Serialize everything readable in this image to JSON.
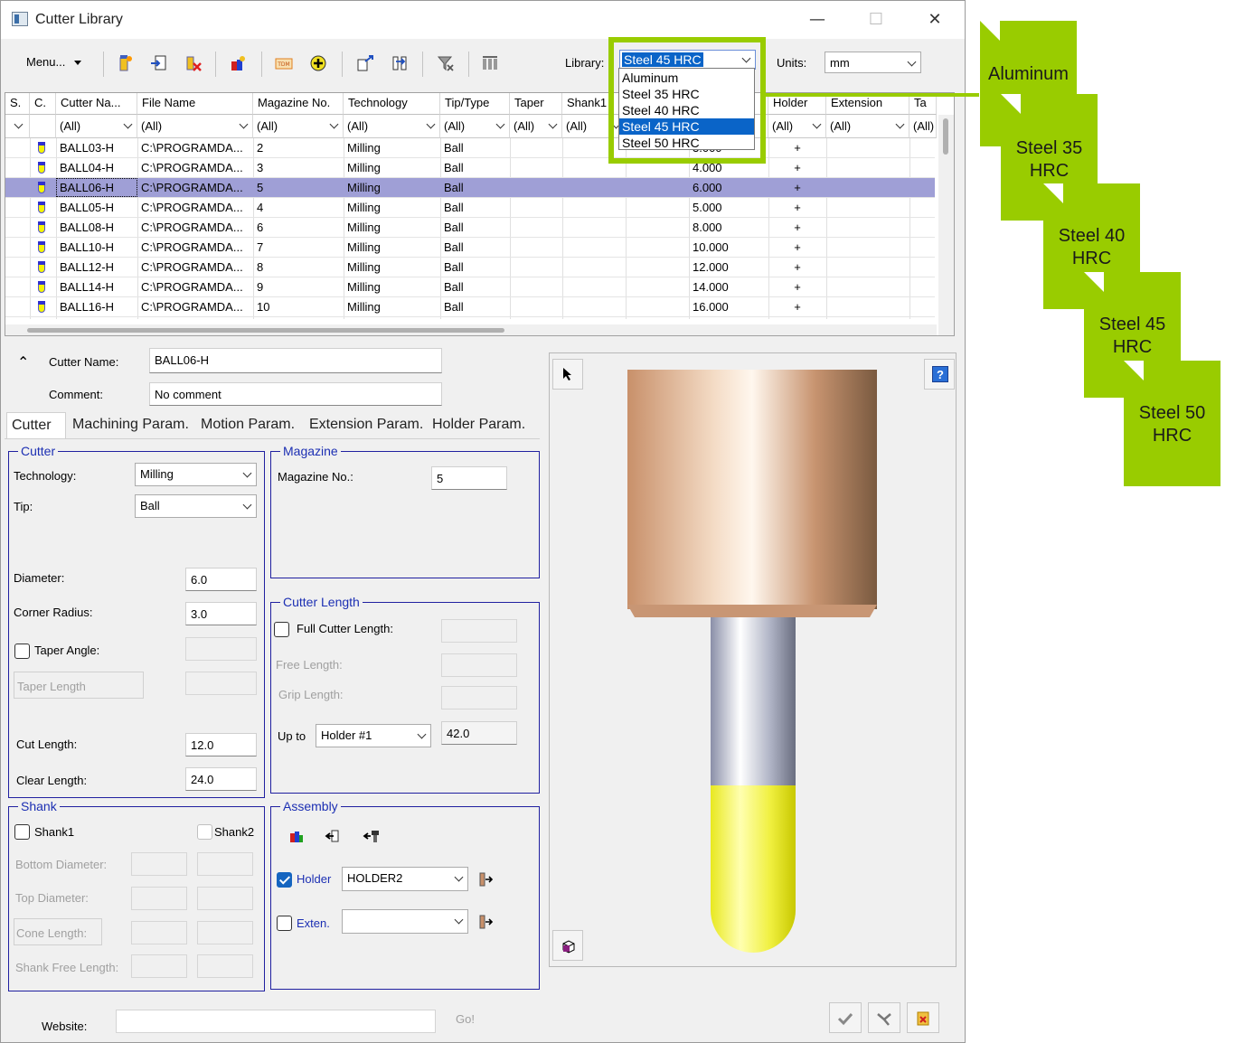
{
  "window": {
    "title": "Cutter Library",
    "minimize_glyph": "—",
    "maximize_glyph": "☐",
    "close_glyph": "✕"
  },
  "toolbar": {
    "menu_label": "Menu...",
    "library_label": "Library:",
    "library_value": "Steel 45 HRC",
    "units_label": "Units:",
    "units_value": "mm",
    "icons": [
      "new-cutter-icon",
      "import-icon",
      "delete-cutter-icon",
      "color-icon",
      "tdm-icon",
      "add-icon",
      "export-icon",
      "transfer-icon",
      "filter-clear-icon",
      "columns-icon"
    ]
  },
  "library_dropdown": {
    "selected": "Steel 45 HRC",
    "options": [
      "Aluminum",
      "Steel 35 HRC",
      "Steel 40 HRC",
      "Steel 45 HRC",
      "Steel 50 HRC"
    ]
  },
  "grid": {
    "columns": [
      "S.",
      "C.",
      "Cutter Na...",
      "File Name",
      "Magazine No.",
      "Technology",
      "Tip/Type",
      "Taper",
      "Shank1",
      "",
      "",
      "Holder",
      "Extension",
      "Ta"
    ],
    "filter_all": "(All)",
    "rows": [
      {
        "name": "BALL03-H",
        "file": "C:\\PROGRAMDA...",
        "mag": "2",
        "tech": "Milling",
        "tip": "Ball",
        "dia": "3.000",
        "holder": "+"
      },
      {
        "name": "BALL04-H",
        "file": "C:\\PROGRAMDA...",
        "mag": "3",
        "tech": "Milling",
        "tip": "Ball",
        "dia": "4.000",
        "holder": "+"
      },
      {
        "name": "BALL06-H",
        "file": "C:\\PROGRAMDA...",
        "mag": "5",
        "tech": "Milling",
        "tip": "Ball",
        "dia": "6.000",
        "holder": "+"
      },
      {
        "name": "BALL05-H",
        "file": "C:\\PROGRAMDA...",
        "mag": "4",
        "tech": "Milling",
        "tip": "Ball",
        "dia": "5.000",
        "holder": "+"
      },
      {
        "name": "BALL08-H",
        "file": "C:\\PROGRAMDA...",
        "mag": "6",
        "tech": "Milling",
        "tip": "Ball",
        "dia": "8.000",
        "holder": "+"
      },
      {
        "name": "BALL10-H",
        "file": "C:\\PROGRAMDA...",
        "mag": "7",
        "tech": "Milling",
        "tip": "Ball",
        "dia": "10.000",
        "holder": "+"
      },
      {
        "name": "BALL12-H",
        "file": "C:\\PROGRAMDA...",
        "mag": "8",
        "tech": "Milling",
        "tip": "Ball",
        "dia": "12.000",
        "holder": "+"
      },
      {
        "name": "BALL14-H",
        "file": "C:\\PROGRAMDA...",
        "mag": "9",
        "tech": "Milling",
        "tip": "Ball",
        "dia": "14.000",
        "holder": "+"
      },
      {
        "name": "BALL16-H",
        "file": "C:\\PROGRAMDA...",
        "mag": "10",
        "tech": "Milling",
        "tip": "Ball",
        "dia": "16.000",
        "holder": "+"
      }
    ]
  },
  "detail": {
    "collapse_glyph": "⌃",
    "cutter_name_label": "Cutter Name:",
    "cutter_name_value": "BALL06-H",
    "comment_label": "Comment:",
    "comment_value": "No comment"
  },
  "tabs": [
    "Cutter",
    "Machining Param.",
    "Motion Param.",
    "Extension Param.",
    "Holder Param."
  ],
  "cutter_group": {
    "title": "Cutter",
    "technology_label": "Technology:",
    "technology_value": "Milling",
    "tip_label": "Tip:",
    "tip_value": "Ball",
    "diameter_label": "Diameter:",
    "diameter_value": "6.0",
    "corner_radius_label": "Corner Radius:",
    "corner_radius_value": "3.0",
    "taper_angle_label": "Taper Angle:",
    "taper_length_label": "Taper Length",
    "cut_length_label": "Cut Length:",
    "cut_length_value": "12.0",
    "clear_length_label": "Clear Length:",
    "clear_length_value": "24.0"
  },
  "magazine_group": {
    "title": "Magazine",
    "magazine_no_label": "Magazine No.:",
    "magazine_no_value": "5"
  },
  "cutter_length_group": {
    "title": "Cutter Length",
    "full_length_label": "Full Cutter Length:",
    "free_length_label": "Free Length:",
    "grip_length_label": "Grip Length:",
    "up_to_label": "Up to",
    "up_to_value": "Holder #1",
    "up_to_length": "42.0"
  },
  "shank_group": {
    "title": "Shank",
    "shank1_label": "Shank1",
    "shank2_label": "Shank2",
    "bottom_diameter_label": "Bottom Diameter:",
    "top_diameter_label": "Top Diameter:",
    "cone_length_label": "Cone Length:",
    "shank_free_length_label": "Shank Free Length:"
  },
  "assembly_group": {
    "title": "Assembly",
    "holder_label": "Holder",
    "holder_value": "HOLDER2",
    "extension_label": "Exten."
  },
  "footer": {
    "website_label": "Website:",
    "go_label": "Go!"
  },
  "preview": {
    "help_glyph": "?"
  },
  "callout_docs": [
    {
      "line1": "Aluminum",
      "line2": ""
    },
    {
      "line1": "Steel 35",
      "line2": "HRC"
    },
    {
      "line1": "Steel 40",
      "line2": "HRC"
    },
    {
      "line1": "Steel 45",
      "line2": "HRC"
    },
    {
      "line1": "Steel 50",
      "line2": "HRC"
    }
  ],
  "colors": {
    "highlight_green": "#99cc00",
    "selection_row": "#9f9fd6",
    "group_border": "#2020a0",
    "dropdown_select": "#0a64c8",
    "holder_copper": "#c8906a",
    "cutter_yellow": "#f0f020"
  }
}
